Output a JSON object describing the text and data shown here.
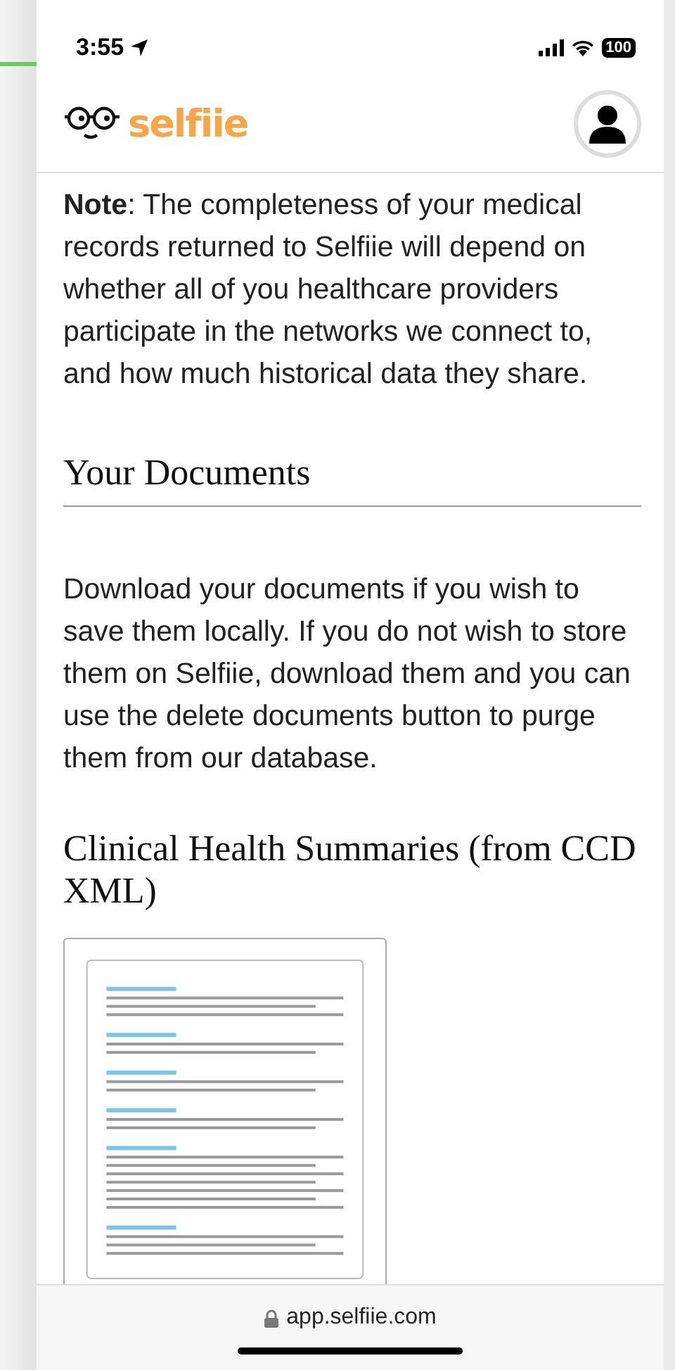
{
  "status_bar": {
    "time": "3:55",
    "battery": "100"
  },
  "header": {
    "logo": "selfiie"
  },
  "note": {
    "text": "**Note**: The completeness of your medical records returned to Selfiie will depend on whether all of you healthcare providers participate in the networks we connect to, and how much historical data they share."
  },
  "documents": {
    "title": "Your Documents",
    "text": "Download your documents if you wish to save them locally. If you do not wish to store them on Selfiie, download them and you can use the delete documents button to purge them from our database."
  },
  "summaries": {
    "title": "Clinical Health Summaries (from CCD XML)"
  },
  "address_bar": {
    "url": "app.selfiie.com"
  }
}
